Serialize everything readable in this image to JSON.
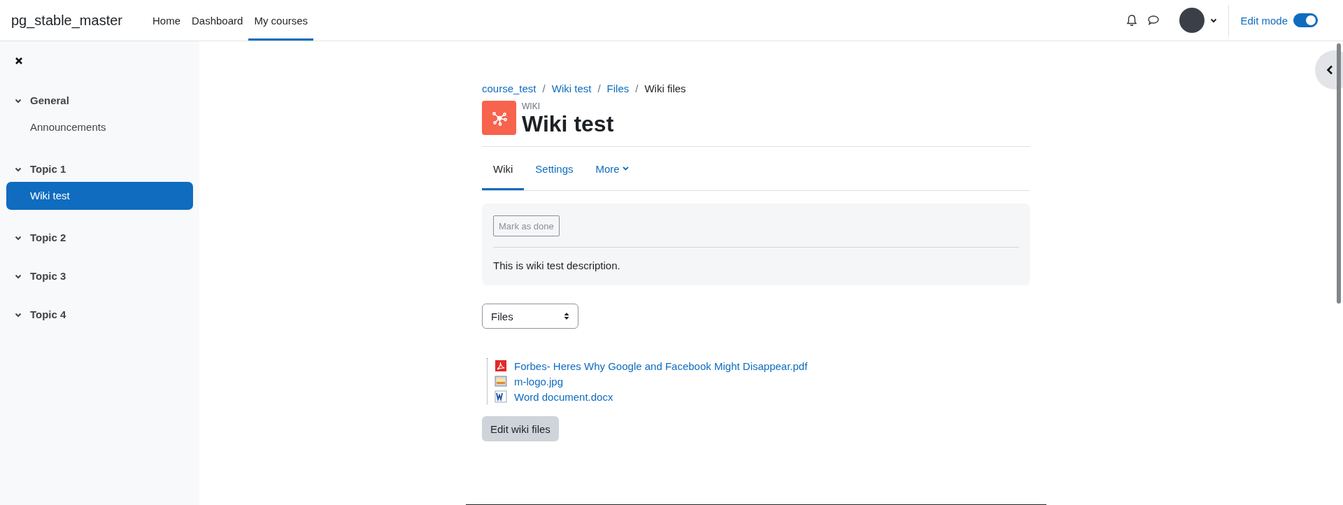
{
  "navbar": {
    "site_name": "pg_stable_master",
    "links": [
      {
        "label": "Home",
        "selected": false
      },
      {
        "label": "Dashboard",
        "selected": false
      },
      {
        "label": "My courses",
        "selected": true
      }
    ],
    "edit_mode": {
      "label": "Edit mode",
      "on": true
    }
  },
  "sidebar": {
    "sections": [
      {
        "title": "General",
        "expanded": true,
        "items": [
          {
            "label": "Announcements",
            "selected": false
          }
        ]
      },
      {
        "title": "Topic 1",
        "expanded": true,
        "items": [
          {
            "label": "Wiki test",
            "selected": true
          }
        ]
      },
      {
        "title": "Topic 2",
        "expanded": true
      },
      {
        "title": "Topic 3",
        "expanded": true
      },
      {
        "title": "Topic 4",
        "expanded": true
      }
    ]
  },
  "breadcrumb": [
    {
      "label": "course_test",
      "kind": "link"
    },
    {
      "separator": "/",
      "label": "Wiki test",
      "kind": "link"
    },
    {
      "separator": "/",
      "label": "Files",
      "kind": "link"
    },
    {
      "separator": "/",
      "label": "Wiki files",
      "kind": "current"
    }
  ],
  "activity": {
    "type_label": "WIKI",
    "title": "Wiki test"
  },
  "tabs": [
    {
      "label": "Wiki",
      "selected": true,
      "kind": "tab"
    },
    {
      "label": "Settings",
      "selected": false,
      "kind": "tab"
    },
    {
      "label": "More",
      "selected": false,
      "kind": "dropdown"
    }
  ],
  "completion": {
    "button": "Mark as done",
    "description": "This is wiki test description."
  },
  "select": {
    "value": "Files"
  },
  "files": [
    {
      "name": "Forbes- Heres Why Google and Facebook Might Disappear.pdf",
      "kind": "pdf"
    },
    {
      "name": "m-logo.jpg",
      "kind": "image"
    },
    {
      "name": "Word document.docx",
      "kind": "word"
    }
  ],
  "edit_button": "Edit wiki files"
}
